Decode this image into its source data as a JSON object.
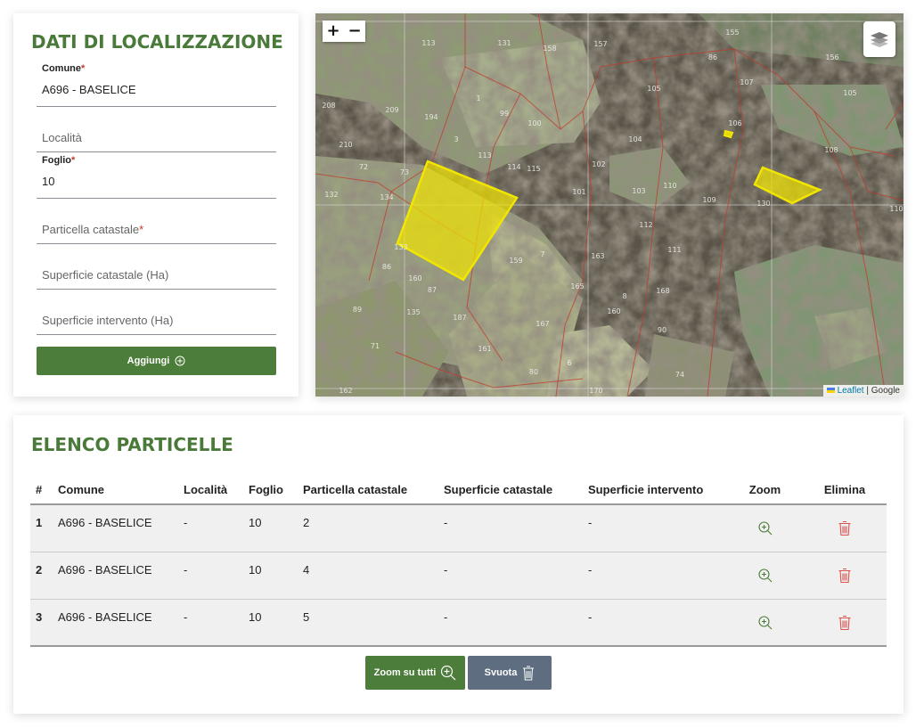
{
  "form": {
    "title": "DATI DI LOCALIZZAZIONE",
    "comune": {
      "label": "Comune",
      "value": "A696 - BASELICE"
    },
    "localita": {
      "placeholder": "Località"
    },
    "foglio": {
      "label": "Foglio",
      "value": "10"
    },
    "particella": {
      "placeholder": "Particella catastale"
    },
    "superficie_catastale": {
      "placeholder": "Superficie catastale (Ha)"
    },
    "superficie_intervento": {
      "placeholder": "Superficie intervento (Ha)"
    },
    "required_mark": "*",
    "add_button": "Aggiungi"
  },
  "map": {
    "zoom_in": "+",
    "zoom_out": "−",
    "attribution_leaflet": "Leaflet",
    "attribution_sep": " | ",
    "attribution_google": "Google",
    "parcel_labels": [
      "113",
      "131",
      "158",
      "157",
      "155",
      "86",
      "156",
      "107",
      "105",
      "105",
      "1",
      "99",
      "100",
      "208",
      "209",
      "194",
      "3",
      "104",
      "106",
      "108",
      "210",
      "72",
      "113",
      "114",
      "115",
      "102",
      "103",
      "110",
      "73",
      "134",
      "132",
      "109",
      "130",
      "110",
      "101",
      "112",
      "133",
      "159",
      "7",
      "163",
      "111",
      "86",
      "160",
      "87",
      "165",
      "8",
      "168",
      "135",
      "89",
      "187",
      "160",
      "167",
      "90",
      "71",
      "161",
      "6",
      "80",
      "74",
      "162",
      "170"
    ]
  },
  "list": {
    "title": "ELENCO PARTICELLE",
    "columns": [
      "#",
      "Comune",
      "Località",
      "Foglio",
      "Particella catastale",
      "Superficie catastale",
      "Superficie intervento",
      "Zoom",
      "Elimina"
    ],
    "rows": [
      {
        "n": "1",
        "comune": "A696 - BASELICE",
        "localita": "-",
        "foglio": "10",
        "particella": "2",
        "sup_cat": "-",
        "sup_int": "-"
      },
      {
        "n": "2",
        "comune": "A696 - BASELICE",
        "localita": "-",
        "foglio": "10",
        "particella": "4",
        "sup_cat": "-",
        "sup_int": "-"
      },
      {
        "n": "3",
        "comune": "A696 - BASELICE",
        "localita": "-",
        "foglio": "10",
        "particella": "5",
        "sup_cat": "-",
        "sup_int": "-"
      }
    ],
    "zoom_all_button": "Zoom su tutti",
    "clear_button": "Svuota"
  },
  "colors": {
    "accent_green": "#4d7d3a",
    "title_green": "#4a7a3a",
    "slate": "#5e6e80",
    "delete_red": "#d9534f",
    "parcel_yellow": "#f2e600"
  }
}
